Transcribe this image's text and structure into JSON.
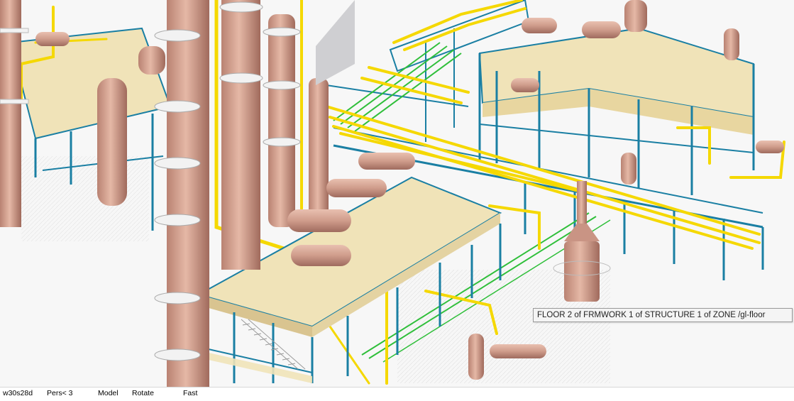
{
  "window": {
    "type": "3D plant design model viewer"
  },
  "scene": {
    "colors": {
      "structure_steel": "#1a7fa3",
      "floor_deck": "#f0e3b8",
      "pipe_yellow": "#f5d800",
      "pipe_green": "#2fbf3a",
      "equipment": "#d4a090",
      "background": "#f6f6f6"
    }
  },
  "tooltip": {
    "text": "FLOOR 2 of FRMWORK 1 of STRUCTURE 1 of ZONE /gl-floor"
  },
  "statusbar": {
    "view_name": "w30s28d",
    "projection": "Pers<  3",
    "mode": "Model",
    "action": "Rotate",
    "speed": "Fast"
  }
}
